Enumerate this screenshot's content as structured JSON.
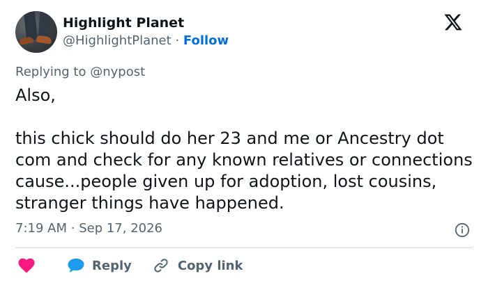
{
  "author": {
    "display_name": "Highlight Planet",
    "handle": "@HighlightPlanet",
    "separator": "·",
    "follow_label": "Follow"
  },
  "reply_context": {
    "prefix": "Replying to",
    "mention": "@nypost"
  },
  "tweet": {
    "line1": "Also,",
    "body": "this chick should do her 23 and me or Ancestry dot com  and check for any known relatives or connections cause...people given up for adoption, lost cousins, stranger things have happened."
  },
  "meta": {
    "time": "7:19 AM",
    "separator": "·",
    "date": "Sep 17, 2026"
  },
  "actions": {
    "reply_label": "Reply",
    "copy_link_label": "Copy link"
  },
  "colors": {
    "accent": "#006fd6",
    "heart": "#f91880",
    "muted": "#536471",
    "text": "#0f1419",
    "divider": "#cfd9de"
  },
  "icons": {
    "platform": "x-logo-icon",
    "info": "info-icon",
    "like": "heart-icon",
    "reply": "speech-bubble-icon",
    "copy": "link-icon"
  }
}
